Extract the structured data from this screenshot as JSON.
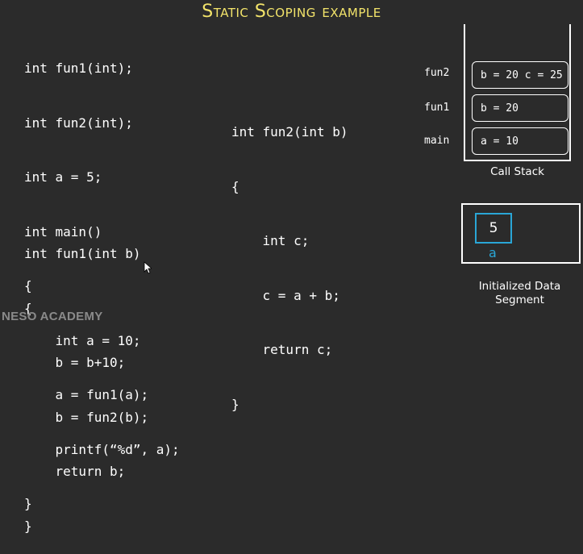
{
  "title": "Static Scoping example",
  "code_left_top": [
    "int fun1(int);",
    "int fun2(int);",
    "int a = 5;",
    "int main()",
    "{",
    "    int a = 10;",
    "    a = fun1(a);",
    "    printf(“%d”, a);",
    "}"
  ],
  "code_left_bottom": [
    "int fun1(int b)",
    "{",
    "    b = b+10;",
    "    b = fun2(b);",
    "    return b;",
    "}"
  ],
  "code_right": [
    "int fun2(int b)",
    "{",
    "    int c;",
    "    c = a + b;",
    "    return c;",
    "}"
  ],
  "call_stack": {
    "caption": "Call Stack",
    "frames": [
      {
        "label": "fun2",
        "content": "b = 20 c = 25"
      },
      {
        "label": "fun1",
        "content": "b = 20"
      },
      {
        "label": "main",
        "content": "a = 10"
      }
    ]
  },
  "data_segment": {
    "caption_line1": "Initialized Data",
    "caption_line2": "Segment",
    "var_value": "5",
    "var_name": "a"
  },
  "watermark": "NESO ACADEMY",
  "colors": {
    "background": "#2b2b2b",
    "title": "#f2e36a",
    "variable_accent": "#2aa6d6"
  }
}
